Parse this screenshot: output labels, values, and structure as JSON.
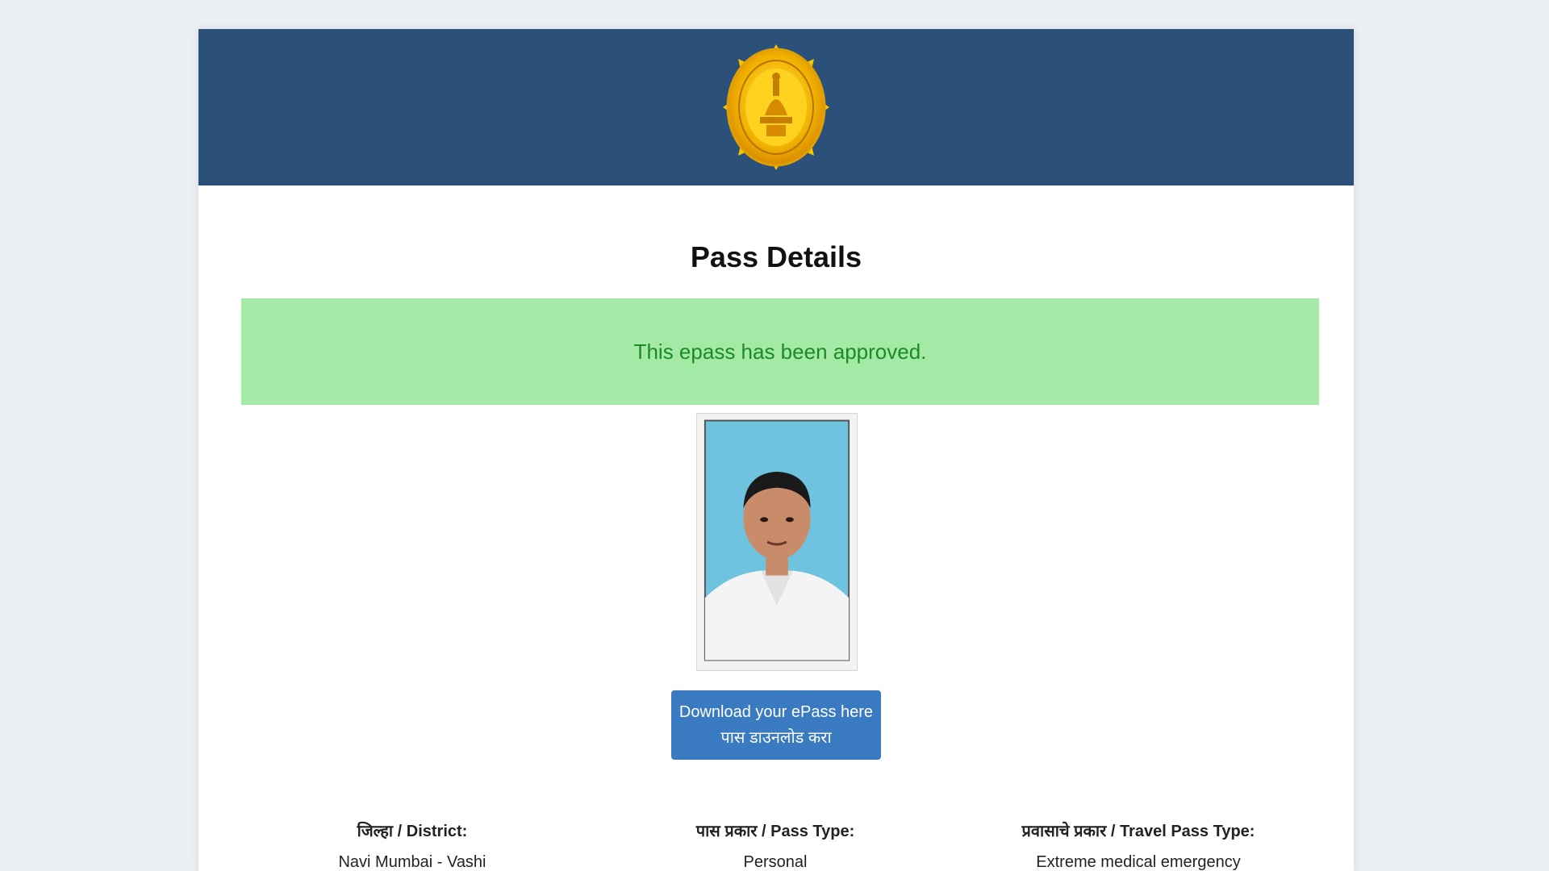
{
  "header": {
    "emblem_icon": "maharashtra-emblem-seal"
  },
  "page": {
    "title": "Pass Details"
  },
  "alert": {
    "message": "This epass has been approved.",
    "status": "approved",
    "bg_color": "#a3eaa6",
    "text_color": "#1d8a24"
  },
  "download": {
    "label_en": "Download your ePass here",
    "label_mr": "पास डाउनलोड करा"
  },
  "details": [
    {
      "label": "जिल्हा / District:",
      "value": "Navi Mumbai - Vashi"
    },
    {
      "label": "पास प्रकार / Pass Type:",
      "value": "Personal"
    },
    {
      "label": "प्रवासाचे प्रकार / Travel Pass Type:",
      "value": "Extreme medical emergency"
    }
  ],
  "colors": {
    "header": "#2b5079",
    "button": "#3a7ac0"
  }
}
